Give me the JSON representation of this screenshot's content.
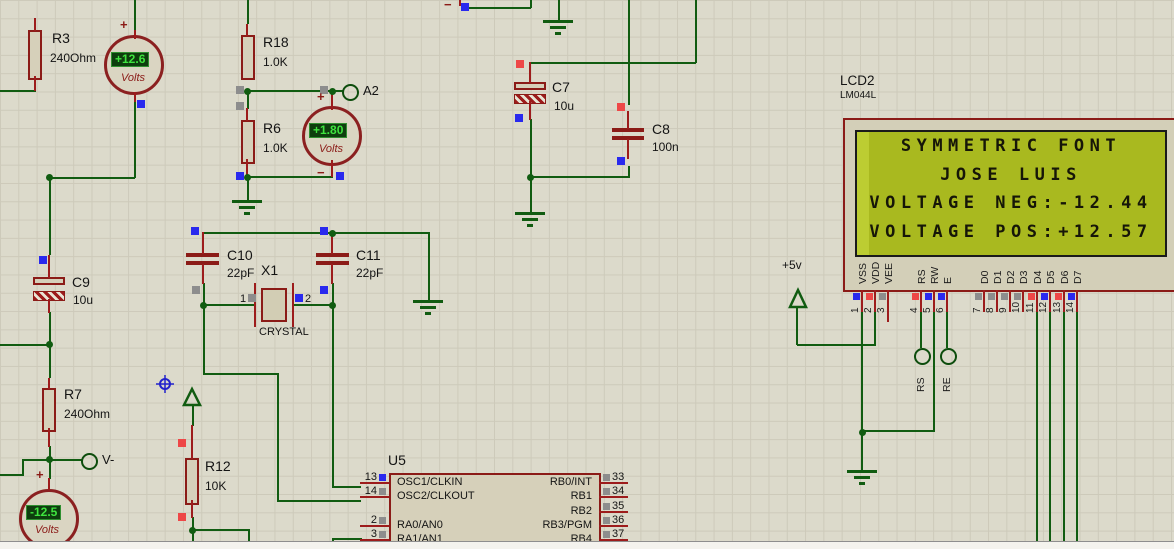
{
  "colors": {
    "wire": "#115c11",
    "outline": "#8b1b17",
    "stub": "#9d1c1c",
    "fill": "#d6d0ba",
    "canvas_bg": "#dcdacb",
    "grid_line": "#cdcaba",
    "indicator_blue": "#2929ee",
    "indicator_red": "#ee4747",
    "indicator_gray": "#8d8d8d",
    "vm_display_bg": "#0e3e0e",
    "vm_display_text": "#3fe43f",
    "lcd_screen": "#a9b91f"
  },
  "components": {
    "r3": {
      "ref": "R3",
      "value": "240Ohm"
    },
    "r18": {
      "ref": "R18",
      "value": "1.0K"
    },
    "r6": {
      "ref": "R6",
      "value": "1.0K"
    },
    "r7": {
      "ref": "R7",
      "value": "240Ohm"
    },
    "r12": {
      "ref": "R12",
      "value": "10K"
    },
    "c7": {
      "ref": "C7",
      "value": "10u"
    },
    "c8": {
      "ref": "C8",
      "value": "100n"
    },
    "c9": {
      "ref": "C9",
      "value": "10u"
    },
    "c10": {
      "ref": "C10",
      "value": "22pF"
    },
    "c11": {
      "ref": "C11",
      "value": "22pF"
    },
    "x1": {
      "ref": "X1",
      "value": "CRYSTAL",
      "pin1": "1",
      "pin2": "2"
    },
    "u5": {
      "ref": "U5"
    }
  },
  "voltmeters": {
    "vm1": {
      "reading": "+12.6",
      "unit": "Volts",
      "plus": "+",
      "minus": "−"
    },
    "vm2": {
      "reading": "+1.80",
      "unit": "Volts",
      "plus": "+",
      "minus": "−"
    },
    "vm3": {
      "reading": "-12.5",
      "unit": "Volts",
      "plus": "+"
    }
  },
  "terminals": {
    "a2": "A2",
    "vminus": "V-",
    "rs": "RS",
    "re": "RE",
    "plus5v": "+5v"
  },
  "partial_top": {
    "minus": "−"
  },
  "lcd": {
    "ref": "LCD2",
    "part": "LM044L",
    "screen_lines": [
      "SYMMETRIC FONT",
      "JOSE LUIS",
      "VOLTAGE NEG:-12.44",
      "VOLTAGE POS:+12.57"
    ],
    "pins": [
      {
        "num": "1",
        "label": "VSS",
        "indicator": "blue"
      },
      {
        "num": "2",
        "label": "VDD",
        "indicator": "red"
      },
      {
        "num": "3",
        "label": "VEE",
        "indicator": "gray"
      },
      {
        "num": "4",
        "label": "RS",
        "indicator": "red"
      },
      {
        "num": "5",
        "label": "RW",
        "indicator": "blue"
      },
      {
        "num": "6",
        "label": "E",
        "indicator": "blue"
      },
      {
        "num": "7",
        "label": "D0",
        "indicator": "gray"
      },
      {
        "num": "8",
        "label": "D1",
        "indicator": "gray"
      },
      {
        "num": "9",
        "label": "D2",
        "indicator": "gray"
      },
      {
        "num": "10",
        "label": "D3",
        "indicator": "gray"
      },
      {
        "num": "11",
        "label": "D4",
        "indicator": "red"
      },
      {
        "num": "12",
        "label": "D5",
        "indicator": "blue"
      },
      {
        "num": "13",
        "label": "D6",
        "indicator": "red"
      },
      {
        "num": "14",
        "label": "D7",
        "indicator": "blue"
      }
    ]
  },
  "u5": {
    "ref": "U5",
    "left_pins": [
      {
        "num": "13",
        "label": "OSC1/CLKIN",
        "indicator": "blue"
      },
      {
        "num": "14",
        "label": "OSC2/CLKOUT",
        "indicator": "gray"
      },
      {
        "num": "2",
        "label": "RA0/AN0",
        "indicator": "gray"
      },
      {
        "num": "3",
        "label": "RA1/AN1",
        "indicator": "gray"
      }
    ],
    "right_pins": [
      {
        "num": "33",
        "label": "RB0/INT",
        "indicator": "gray"
      },
      {
        "num": "34",
        "label": "RB1",
        "indicator": "gray"
      },
      {
        "num": "35",
        "label": "RB2",
        "indicator": "gray"
      },
      {
        "num": "36",
        "label": "RB3/PGM",
        "indicator": "gray"
      },
      {
        "num": "37",
        "label": "RB4",
        "indicator": "gray"
      }
    ]
  }
}
